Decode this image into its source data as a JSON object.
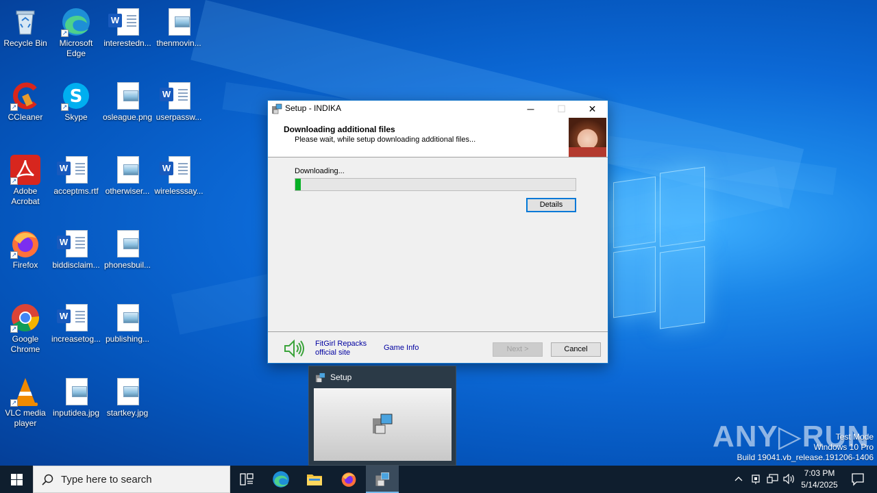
{
  "desktop": {
    "icons": [
      {
        "label": "Recycle Bin",
        "icon": "recycle-bin-icon"
      },
      {
        "label": "Microsoft Edge",
        "icon": "edge-icon"
      },
      {
        "label": "interestedn...",
        "icon": "word-doc-icon"
      },
      {
        "label": "thenmovin...",
        "icon": "image-file-icon"
      },
      {
        "label": "CCleaner",
        "icon": "ccleaner-icon"
      },
      {
        "label": "Skype",
        "icon": "skype-icon"
      },
      {
        "label": "osleague.png",
        "icon": "image-file-icon"
      },
      {
        "label": "userpassw...",
        "icon": "word-doc-icon"
      },
      {
        "label": "Adobe Acrobat",
        "icon": "acrobat-icon"
      },
      {
        "label": "acceptms.rtf",
        "icon": "word-doc-icon"
      },
      {
        "label": "otherwiser...",
        "icon": "image-file-icon"
      },
      {
        "label": "wirelesssay...",
        "icon": "word-doc-icon"
      },
      {
        "label": "Firefox",
        "icon": "firefox-icon"
      },
      {
        "label": "biddisclaim...",
        "icon": "word-doc-icon"
      },
      {
        "label": "phonesbuil...",
        "icon": "image-file-icon"
      },
      {
        "label": "Google Chrome",
        "icon": "chrome-icon"
      },
      {
        "label": "increasetog...",
        "icon": "word-doc-icon"
      },
      {
        "label": "publishing...",
        "icon": "image-file-icon"
      },
      {
        "label": "VLC media player",
        "icon": "vlc-icon"
      },
      {
        "label": "inputidea.jpg",
        "icon": "image-file-icon"
      },
      {
        "label": "startkey.jpg",
        "icon": "image-file-icon"
      }
    ]
  },
  "setup_window": {
    "title": "Setup - INDIKA",
    "minimize": "─",
    "maximize": "☐",
    "close": "✕",
    "header_title": "Downloading additional files",
    "header_subtitle": "Please wait, while setup downloading additional files...",
    "status": "Downloading...",
    "progress": 0.02,
    "details_button": "Details",
    "link_fitgirl_line1": "FitGirl Repacks",
    "link_fitgirl_line2": "official site",
    "link_game_info": "Game Info",
    "next_button": "Next >",
    "cancel_button": "Cancel"
  },
  "thumbnail": {
    "title": "Setup"
  },
  "taskbar": {
    "search_placeholder": "Type here to search",
    "time": "7:03 PM",
    "date": "5/14/2025"
  },
  "watermark": {
    "line1": "Test Mode",
    "line2": "Windows 10 Pro",
    "line3": "Build 19041.vb_release.191206-1406"
  },
  "colors": {
    "accent": "#0078d7",
    "progress_fill": "#06b025",
    "taskbar": "#0f1e2e"
  }
}
